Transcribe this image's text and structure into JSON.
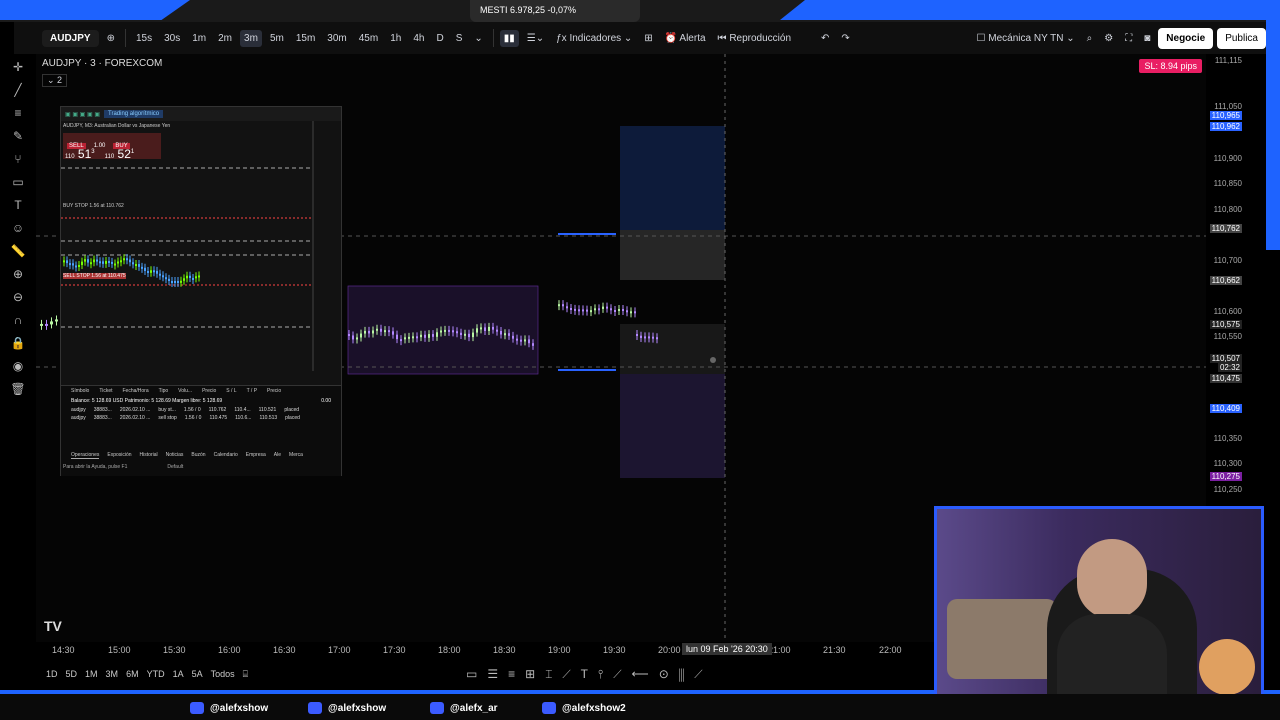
{
  "tab": {
    "title": "MESTI  6.978,25  -0,07%"
  },
  "toolbar": {
    "symbol": "AUDJPY",
    "intervals": [
      "15s",
      "30s",
      "1m",
      "2m",
      "3m",
      "5m",
      "15m",
      "30m",
      "45m",
      "1h",
      "4h",
      "D",
      "S"
    ],
    "indicators": "Indicadores",
    "alert": "Alerta",
    "replay": "Reproducción",
    "layout_name": "Mecánica NY TN",
    "trade_button": "Negocie",
    "publish_button": "Publica"
  },
  "chart": {
    "title": "AUDJPY · 3 · FOREXCOM",
    "legend_count": "2",
    "sl_badge": "SL: 8.94 pips",
    "price_ticks": [
      "111,115",
      "111,050",
      "110,965",
      "110,962",
      "110,900",
      "110,850",
      "110,800",
      "110,762",
      "110,700",
      "110,662",
      "110,600",
      "110,575",
      "110,550",
      "110,507",
      "02:32",
      "110,475",
      "110,409",
      "110,350",
      "110,300",
      "110,275",
      "110,250"
    ],
    "time_ticks": [
      "14:30",
      "15:00",
      "15:30",
      "16:00",
      "16:30",
      "17:00",
      "17:30",
      "18:00",
      "18:30",
      "19:00",
      "19:30",
      "20:00",
      "21:00",
      "21:30",
      "22:00"
    ],
    "crosshair_time": "lun 09 Feb '26   20:30",
    "accent_blue": "#2962ff",
    "up_color": "#b9f6a4",
    "down_color": "#b388ff"
  },
  "mt_panel": {
    "title": "AUDJPY, M3: Australian Dollar vs Japanese Yen",
    "sell_label": "SELL",
    "buy_label": "BUY",
    "lot": "1.00",
    "sell_price_big": "51",
    "sell_price_prefix": "110",
    "sell_price_sup": "3",
    "buy_price_big": "52",
    "buy_price_prefix": "110",
    "buy_price_sup": "1",
    "algo_button": "Trading algorítmico",
    "buy_stop_label": "BUY STOP 1.56 at 110.762",
    "sell_stop_label": "SELL STOP 1.56 at 110.475",
    "table_headers": [
      "Símbolo",
      "Ticket",
      "Fecha/Hora",
      "Tipo",
      "Volu...",
      "Precio",
      "S / L",
      "T / P",
      "Precio",
      ""
    ],
    "balance_row": "Balance: 5 128.69 USD  Patrimonio: 5 128.69  Margen libre: 5 128.69",
    "balance_value": "0.00",
    "rows": [
      [
        "audjpy",
        "38883...",
        "2026.02.10 ...",
        "buy st...",
        "1.56 / 0",
        "110.762",
        "110.4...",
        "110.521",
        "placed"
      ],
      [
        "audjpy",
        "38883...",
        "2026.02.10 ...",
        "sell stop",
        "1.56 / 0",
        "110.475",
        "110.6...",
        "110.513",
        "placed"
      ]
    ],
    "tabs": [
      "Operaciones",
      "Exposición",
      "Historial",
      "Noticias",
      "Buzón",
      "Calendario",
      "Empresa",
      "Ale",
      "Merca"
    ],
    "status_left": "Para abrir la Ayuda, pulse F1",
    "status_right": "Default"
  },
  "bottom": {
    "ranges": [
      "1D",
      "5D",
      "1M",
      "3M",
      "6M",
      "YTD",
      "1A",
      "5A",
      "Todos"
    ]
  },
  "socials": [
    {
      "icon": "tiktok-icon",
      "handle": "@alefxshow"
    },
    {
      "icon": "x-icon",
      "handle": "@alefxshow"
    },
    {
      "icon": "instagram-icon",
      "handle": "@alefx_ar"
    },
    {
      "icon": "youtube-icon",
      "handle": "@alefxshow2"
    }
  ],
  "watermark": "TV"
}
